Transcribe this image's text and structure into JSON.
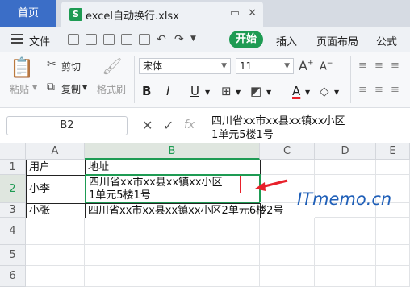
{
  "tabs": {
    "home": "首页",
    "file_title": "excel自动换行.xlsx",
    "file_icon": "S"
  },
  "menu": {
    "file": "文件",
    "start": "开始",
    "insert": "插入",
    "page_layout": "页面布局",
    "formulas": "公式"
  },
  "ribbon": {
    "paste": "粘贴",
    "cut": "剪切",
    "copy": "复制",
    "format_painter": "格式刷",
    "font_name": "宋体",
    "font_size": "11",
    "bold": "B",
    "italic": "I",
    "underline": "U",
    "font_color": "A",
    "grow_font": "A",
    "shrink_font": "A"
  },
  "formula_bar": {
    "cell_ref": "B2",
    "content": "四川省xx市xx县xx镇xx小区\n1单元5楼1号",
    "fx": "fx"
  },
  "sheet": {
    "columns": [
      "A",
      "B",
      "C",
      "D",
      "E"
    ],
    "rows": [
      "1",
      "2",
      "3",
      "4",
      "5",
      "6"
    ],
    "a1": "用户",
    "b1": "地址",
    "a2": "小李",
    "b2": "四川省xx市xx县xx镇xx小区\n1单元5楼1号",
    "a3": "小张",
    "b3": "四川省xx市xx县xx镇xx小区2单元6楼2号"
  },
  "watermark": "ITmemo.cn",
  "colors": {
    "accent_green": "#1e9b53",
    "tab_blue": "#3b6ec7",
    "arrow_red": "#e8212b",
    "watermark_blue": "#1f5fb8"
  }
}
